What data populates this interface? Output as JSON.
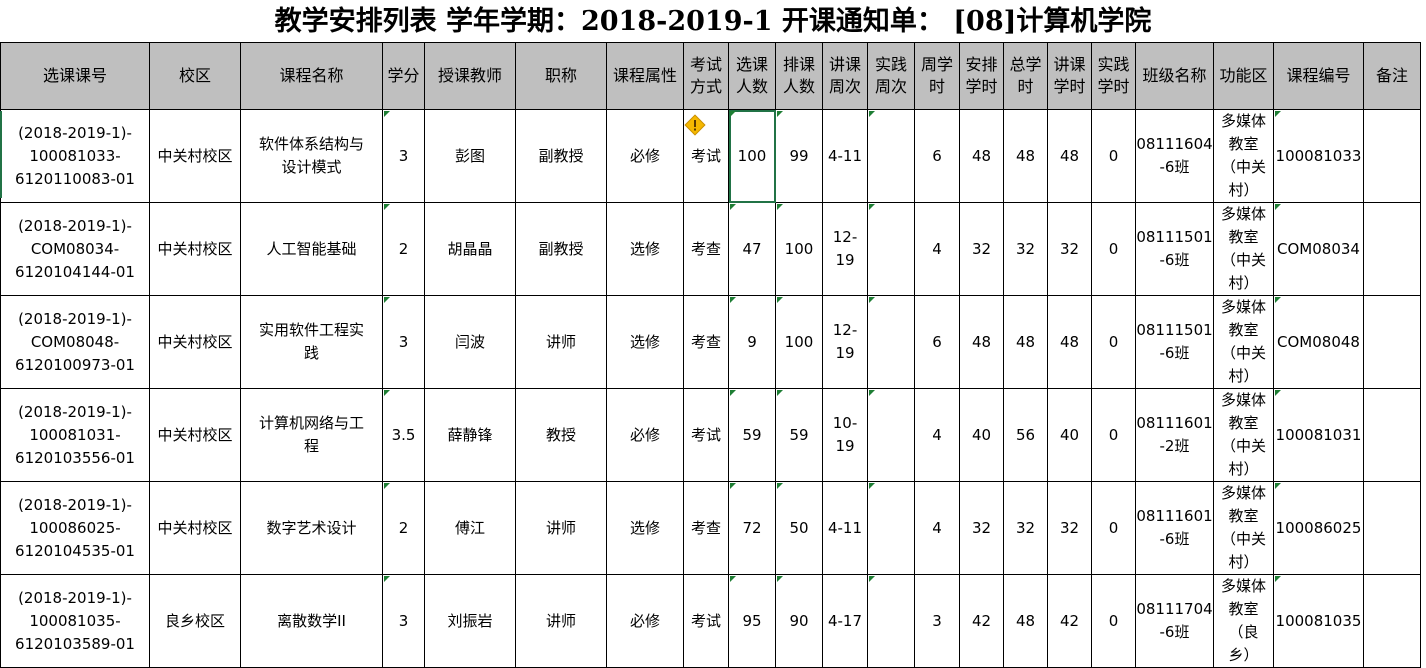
{
  "title": "教学安排列表 学年学期：2018-2019-1 开课通知单：  [08]计算机学院",
  "columns": [
    {
      "lines": [
        "选课课号"
      ]
    },
    {
      "lines": [
        "校区"
      ]
    },
    {
      "lines": [
        "课程名称"
      ]
    },
    {
      "lines": [
        "学分"
      ]
    },
    {
      "lines": [
        "授课教师"
      ]
    },
    {
      "lines": [
        "职称"
      ]
    },
    {
      "lines": [
        "课程属性"
      ]
    },
    {
      "lines": [
        "考试",
        "方式"
      ]
    },
    {
      "lines": [
        "选课",
        "人数"
      ]
    },
    {
      "lines": [
        "排课",
        "人数"
      ]
    },
    {
      "lines": [
        "讲课",
        "周次"
      ]
    },
    {
      "lines": [
        "实践",
        "周次"
      ]
    },
    {
      "lines": [
        "周学",
        "时"
      ]
    },
    {
      "lines": [
        "安排",
        "学时"
      ]
    },
    {
      "lines": [
        "总学",
        "时"
      ]
    },
    {
      "lines": [
        "讲课",
        "学时"
      ]
    },
    {
      "lines": [
        "实践",
        "学时"
      ]
    },
    {
      "lines": [
        "班级名称"
      ]
    },
    {
      "lines": [
        "功能区"
      ]
    },
    {
      "lines": [
        "课程编号"
      ]
    },
    {
      "lines": [
        "备注"
      ]
    }
  ],
  "rows": [
    {
      "cells": [
        [
          "(2018-2019-1)-",
          "100081033-",
          "6120110083-01"
        ],
        [
          "中关村校区"
        ],
        [
          "软件体系结构与",
          "设计模式"
        ],
        [
          "3"
        ],
        [
          "彭图"
        ],
        [
          "副教授"
        ],
        [
          "必修"
        ],
        [
          "考试"
        ],
        [
          "100"
        ],
        [
          "99"
        ],
        [
          "4-11"
        ],
        [
          ""
        ],
        [
          "6"
        ],
        [
          "48"
        ],
        [
          "48"
        ],
        [
          "48"
        ],
        [
          "0"
        ],
        [
          "08111604",
          "-6班"
        ],
        [
          "多媒体",
          "教室",
          "（中关",
          "村）"
        ],
        [
          "100081033"
        ],
        [
          ""
        ]
      ]
    },
    {
      "cells": [
        [
          "(2018-2019-1)-",
          "COM08034-",
          "6120104144-01"
        ],
        [
          "中关村校区"
        ],
        [
          "人工智能基础"
        ],
        [
          "2"
        ],
        [
          "胡晶晶"
        ],
        [
          "副教授"
        ],
        [
          "选修"
        ],
        [
          "考查"
        ],
        [
          "47"
        ],
        [
          "100"
        ],
        [
          "12-",
          "19"
        ],
        [
          ""
        ],
        [
          "4"
        ],
        [
          "32"
        ],
        [
          "32"
        ],
        [
          "32"
        ],
        [
          "0"
        ],
        [
          "08111501",
          "-6班"
        ],
        [
          "多媒体",
          "教室",
          "（中关",
          "村）"
        ],
        [
          "COM08034"
        ],
        [
          ""
        ]
      ]
    },
    {
      "cells": [
        [
          "(2018-2019-1)-",
          "COM08048-",
          "6120100973-01"
        ],
        [
          "中关村校区"
        ],
        [
          "实用软件工程实",
          "践"
        ],
        [
          "3"
        ],
        [
          "闫波"
        ],
        [
          "讲师"
        ],
        [
          "选修"
        ],
        [
          "考查"
        ],
        [
          "9"
        ],
        [
          "100"
        ],
        [
          "12-",
          "19"
        ],
        [
          ""
        ],
        [
          "6"
        ],
        [
          "48"
        ],
        [
          "48"
        ],
        [
          "48"
        ],
        [
          "0"
        ],
        [
          "08111501",
          "-6班"
        ],
        [
          "多媒体",
          "教室",
          "（中关",
          "村）"
        ],
        [
          "COM08048"
        ],
        [
          ""
        ]
      ]
    },
    {
      "cells": [
        [
          "(2018-2019-1)-",
          "100081031-",
          "6120103556-01"
        ],
        [
          "中关村校区"
        ],
        [
          "计算机网络与工",
          "程"
        ],
        [
          "3.5"
        ],
        [
          "薛静锋"
        ],
        [
          "教授"
        ],
        [
          "必修"
        ],
        [
          "考试"
        ],
        [
          "59"
        ],
        [
          "59"
        ],
        [
          "10-",
          "19"
        ],
        [
          ""
        ],
        [
          "4"
        ],
        [
          "40"
        ],
        [
          "56"
        ],
        [
          "40"
        ],
        [
          "0"
        ],
        [
          "08111601",
          "-2班"
        ],
        [
          "多媒体",
          "教室",
          "（中关",
          "村）"
        ],
        [
          "100081031"
        ],
        [
          ""
        ]
      ]
    },
    {
      "cells": [
        [
          "(2018-2019-1)-",
          "100086025-",
          "6120104535-01"
        ],
        [
          "中关村校区"
        ],
        [
          "数字艺术设计"
        ],
        [
          "2"
        ],
        [
          "傅江"
        ],
        [
          "讲师"
        ],
        [
          "选修"
        ],
        [
          "考查"
        ],
        [
          "72"
        ],
        [
          "50"
        ],
        [
          "4-11"
        ],
        [
          ""
        ],
        [
          "4"
        ],
        [
          "32"
        ],
        [
          "32"
        ],
        [
          "32"
        ],
        [
          "0"
        ],
        [
          "08111601",
          "-6班"
        ],
        [
          "多媒体",
          "教室",
          "（中关",
          "村）"
        ],
        [
          "100086025"
        ],
        [
          ""
        ]
      ]
    },
    {
      "cells": [
        [
          "(2018-2019-1)-",
          "100081035-",
          "6120103589-01"
        ],
        [
          "良乡校区"
        ],
        [
          "离散数学II"
        ],
        [
          "3"
        ],
        [
          "刘振岩"
        ],
        [
          "讲师"
        ],
        [
          "必修"
        ],
        [
          "考试"
        ],
        [
          "95"
        ],
        [
          "90"
        ],
        [
          "4-17"
        ],
        [
          ""
        ],
        [
          "3"
        ],
        [
          "42"
        ],
        [
          "48"
        ],
        [
          "42"
        ],
        [
          "0"
        ],
        [
          "08111704",
          "-6班"
        ],
        [
          "多媒体",
          "教室",
          "（良",
          "乡）"
        ],
        [
          "100081035"
        ],
        [
          ""
        ]
      ]
    }
  ],
  "selected_cell": {
    "row": 0,
    "col": 8
  },
  "warning_icon": "warning-diamond-icon",
  "colors": {
    "header_bg": "#bfbfbf",
    "selection": "#217346",
    "comment_mark": "#1e7e34",
    "warning": "#f5b800"
  }
}
